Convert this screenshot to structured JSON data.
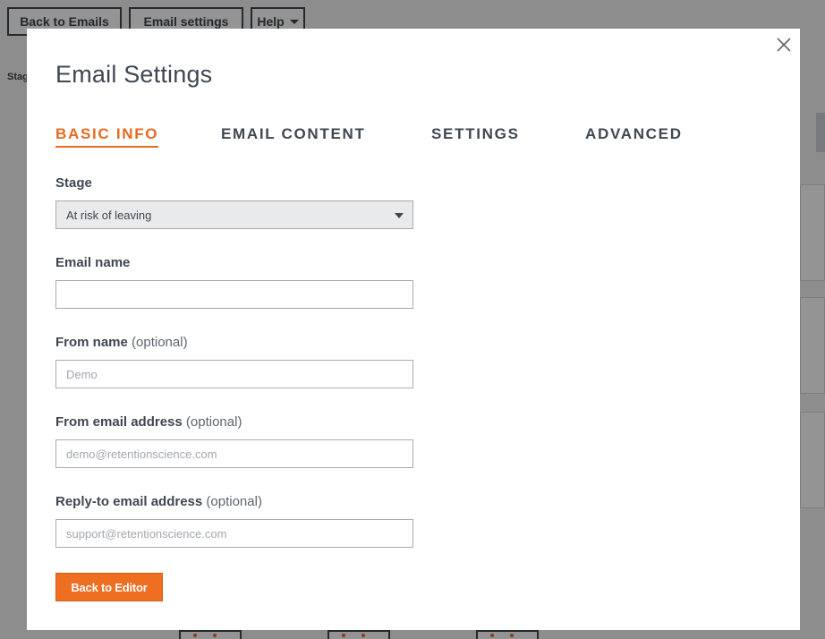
{
  "background": {
    "buttons": {
      "back_to_emails": "Back to Emails",
      "email_settings": "Email settings",
      "help": "Help"
    },
    "stage_text": "Stag",
    "right_label": "r"
  },
  "modal": {
    "title": "Email Settings",
    "close_icon": "close-icon",
    "tabs": [
      {
        "label": "BASIC INFO",
        "active": true
      },
      {
        "label": "EMAIL CONTENT",
        "active": false
      },
      {
        "label": "SETTINGS",
        "active": false
      },
      {
        "label": "ADVANCED",
        "active": false
      }
    ],
    "stage": {
      "label": "Stage",
      "selected": "At risk of leaving"
    },
    "email_name": {
      "label": "Email name",
      "value": "",
      "placeholder": ""
    },
    "from_name": {
      "label": "From name",
      "optional": "(optional)",
      "placeholder": "Demo"
    },
    "from_email": {
      "label": "From email address",
      "optional": "(optional)",
      "placeholder": "demo@retentionscience.com"
    },
    "reply_to": {
      "label": "Reply-to email address",
      "optional": "(optional)",
      "placeholder": "support@retentionscience.com"
    },
    "back_to_editor_label": "Back to Editor"
  },
  "colors": {
    "accent": "#e86a1f",
    "text": "#3f4751",
    "overlay": "rgba(0,0,0,0.42)"
  }
}
